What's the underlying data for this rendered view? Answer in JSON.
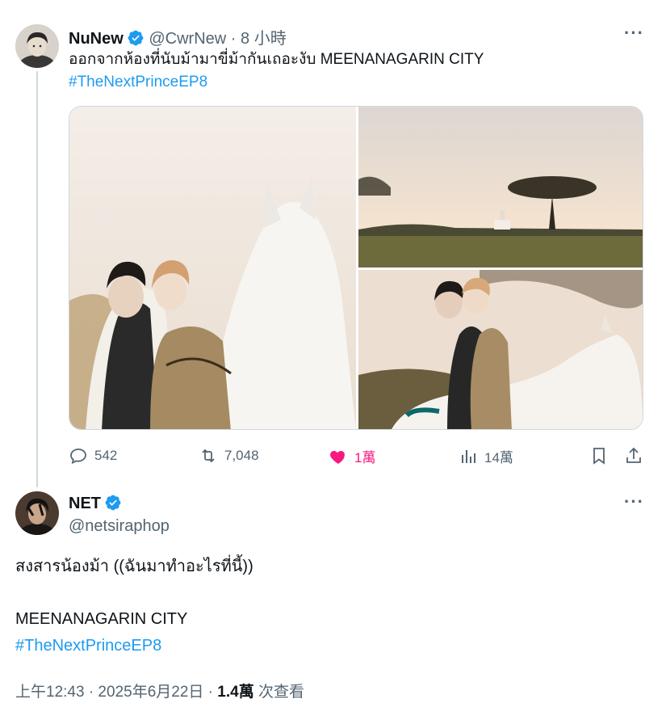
{
  "tweet1": {
    "name": "NuNew",
    "handle": "@CwrNew",
    "separator": "·",
    "time": "8 小時",
    "text": "ออกจากห้องที่นับม้ามาขี่ม้ากันเถอะงับ MEENANAGARIN CITY",
    "hashtag": "#TheNextPrinceEP8",
    "stats": {
      "replies": "542",
      "retweets": "7,048",
      "likes": "1萬",
      "views": "14萬"
    }
  },
  "tweet2": {
    "name": "NET",
    "handle": "@netsiraphop",
    "line1": "สงสารน้องม้า ((ฉันมาทำอะไรที่นี้))",
    "line2": "MEENANAGARIN CITY",
    "hashtag": "#TheNextPrinceEP8",
    "timestamp": "上午12:43 · 2025年6月22日 · ",
    "views_count": "1.4萬",
    "views_label": " 次查看"
  },
  "icons": {
    "verified": "verified-badge-icon",
    "more": "more-icon",
    "reply": "reply-icon",
    "retweet": "retweet-icon",
    "like": "heart-icon",
    "views": "views-icon",
    "bookmark": "bookmark-icon",
    "share": "share-icon"
  },
  "colors": {
    "accent": "#1d9bf0",
    "like": "#f91880",
    "muted": "#536471"
  }
}
